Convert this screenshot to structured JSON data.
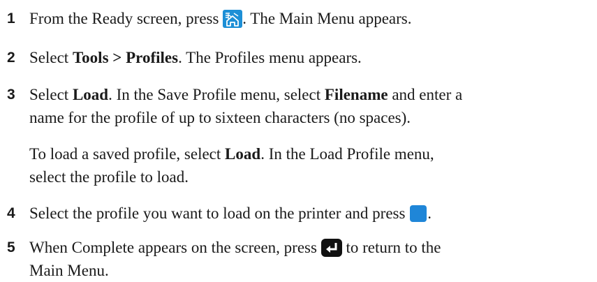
{
  "steps": [
    {
      "number": "1",
      "before": "From the Ready screen, press ",
      "icon": "home-menu-icon",
      "after": ". The Main Menu appears."
    },
    {
      "number": "2",
      "before": "Select ",
      "bold": "Tools > Profiles",
      "after": ". The Profiles menu appears."
    },
    {
      "number": "3",
      "before": "Select ",
      "bold1": "Load",
      "middle": ". In the Save Profile menu, select ",
      "bold2": "Filename",
      "after": " and enter a",
      "line2": "name for the profile of up to sixteen characters (no spaces)."
    },
    {
      "number": "4",
      "before": "Select the profile you want to load on the printer and press ",
      "icon": "blue-select-button-icon",
      "after": "."
    },
    {
      "number": "5",
      "before": "When Complete appears on the screen, press ",
      "icon": "enter-return-icon",
      "after": " to return to the",
      "line2": "Main Menu."
    }
  ],
  "note": {
    "before": "To load a saved profile, select ",
    "bold": "Load",
    "after": ". In the Load Profile menu,",
    "line2": "select the profile to load."
  },
  "colors": {
    "text": "#1a1a1a",
    "home_icon_bg": "#1d8fd6",
    "select_button": "#1f86d8",
    "enter_icon_bg": "#111111"
  }
}
